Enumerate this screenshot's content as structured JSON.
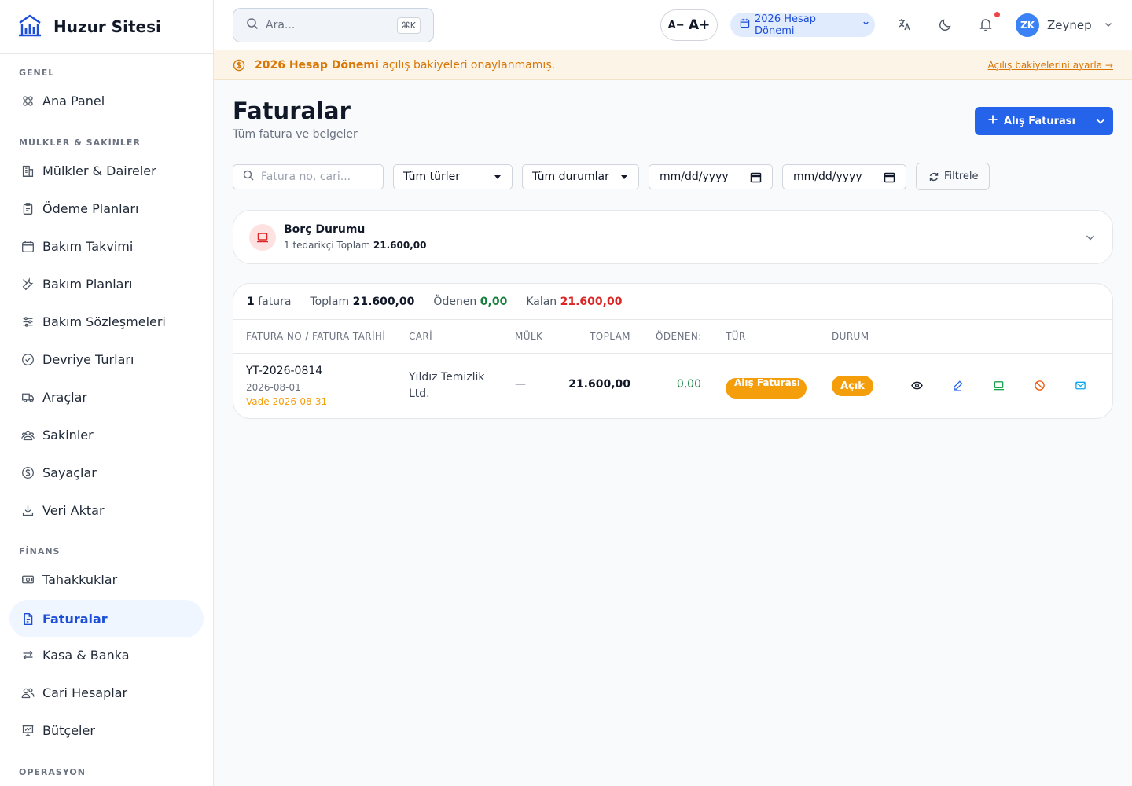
{
  "app": {
    "name": "Huzur Sitesi"
  },
  "sidebar": {
    "sections": [
      {
        "label": "GENEL"
      },
      {
        "label": "MÜLKLER & SAKİNLER"
      },
      {
        "label": "FİNANS"
      },
      {
        "label": "OPERASYON"
      }
    ],
    "items": [
      {
        "label": "Ana Panel",
        "icon": "grid-icon"
      },
      {
        "label": "Mülkler & Daireler",
        "icon": "building-icon"
      },
      {
        "label": "Ödeme Planları",
        "icon": "clipboard-icon"
      },
      {
        "label": "Bakım Takvimi",
        "icon": "calendar-icon"
      },
      {
        "label": "Bakım Planları",
        "icon": "wrench-icon"
      },
      {
        "label": "Bakım Sözleşmeleri",
        "icon": "sliders-icon"
      },
      {
        "label": "Devriye Turları",
        "icon": "check-circle-icon"
      },
      {
        "label": "Araçlar",
        "icon": "truck-icon"
      },
      {
        "label": "Sakinler",
        "icon": "users-icon"
      },
      {
        "label": "Sayaçlar",
        "icon": "dollar-circle-icon"
      },
      {
        "label": "Veri Aktar",
        "icon": "download-icon"
      },
      {
        "label": "Tahakkuklar",
        "icon": "banknote-icon"
      },
      {
        "label": "Faturalar",
        "icon": "document-icon",
        "active": true
      },
      {
        "label": "Kasa & Banka",
        "icon": "arrows-icon"
      },
      {
        "label": "Cari Hesaplar",
        "icon": "people-icon"
      },
      {
        "label": "Bütçeler",
        "icon": "presentation-icon"
      }
    ]
  },
  "topbar": {
    "search_placeholder": "Ara...",
    "shortcut": "⌘K",
    "font_smaller": "A−",
    "font_larger": "A+",
    "period": "2026 Hesap Dönemi",
    "user_initials": "ZK",
    "user_name": "Zeynep"
  },
  "banner": {
    "bold": "2026 Hesap Dönemi",
    "text": " açılış bakiyeleri onaylanmamış.",
    "link": "Açılış bakiyelerini ayarla →"
  },
  "page": {
    "title": "Faturalar",
    "subtitle": "Tüm fatura ve belgeler",
    "new_button": "Alış Faturası"
  },
  "filters": {
    "search_placeholder": "Fatura no, cari...",
    "type": "Tüm türler",
    "status": "Tüm durumlar",
    "date_from": "mm/dd/yyyy",
    "date_to": "mm/dd/yyyy",
    "button": "Filtrele"
  },
  "debt": {
    "title": "Borç Durumu",
    "sub_prefix": "1 tedarikçi Toplam ",
    "sub_total": "21.600,00"
  },
  "summary": {
    "count": "1",
    "count_label": " fatura",
    "total_label": "Toplam ",
    "total": "21.600,00",
    "paid_label": "Ödenen ",
    "paid": "0,00",
    "remaining_label": "Kalan ",
    "remaining": "21.600,00"
  },
  "table": {
    "headers": [
      "FATURA NO / FATURA TARİHİ",
      "CARİ",
      "MÜLK",
      "TOPLAM",
      "ÖDENEN:",
      "TÜR",
      "DURUM"
    ],
    "rows": [
      {
        "no": "YT-2026-0814",
        "date": "2026-08-01",
        "due": "Vade 2026-08-31",
        "cari": "Yıldız Temizlik Ltd.",
        "mulk": "—",
        "toplam": "21.600,00",
        "odenen": "0,00",
        "tur": "Alış Faturası",
        "durum": "Açık"
      }
    ]
  },
  "colors": {
    "accent": "#2563eb",
    "warning": "#f59e0b",
    "success": "#15803d",
    "danger": "#dc2626"
  }
}
